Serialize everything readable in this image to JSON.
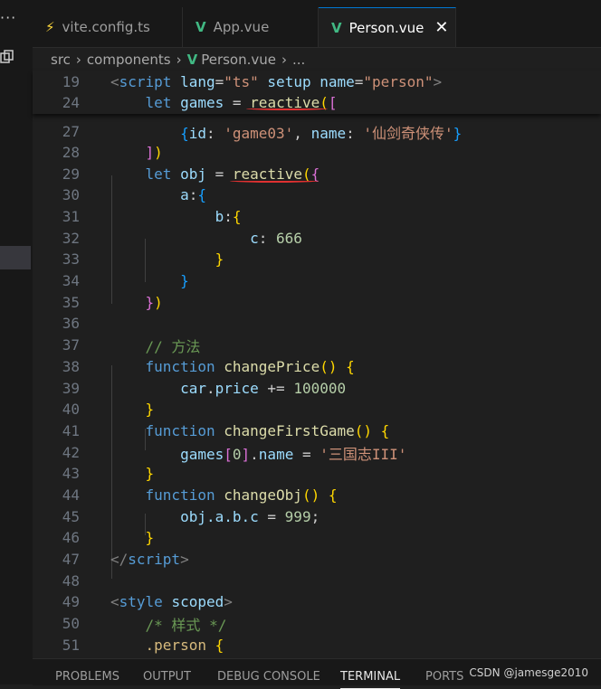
{
  "activity_bar": {
    "more": "···"
  },
  "tabs": [
    {
      "label": "vite.config.ts",
      "icon": "vite-icon"
    },
    {
      "label": "App.vue",
      "icon": "vue-icon"
    },
    {
      "label": "Person.vue",
      "icon": "vue-icon",
      "active": true,
      "close": "✕"
    }
  ],
  "breadcrumb": {
    "part1": "src",
    "part2": "components",
    "part3": "Person.vue",
    "part4": "..."
  },
  "sticky": {
    "l19_num": "19",
    "l19_open": "<",
    "l19_tag": "script",
    "l19_attr1": "lang",
    "l19_eq1": "=",
    "l19_val1": "\"ts\"",
    "l19_attr2": "setup",
    "l19_attr3": "name",
    "l19_eq2": "=",
    "l19_val2": "\"person\"",
    "l19_close": ">",
    "l24_num": "24",
    "l24_let": "let",
    "l24_var": "games",
    "l24_eq": "=",
    "l24_fn": "reactive",
    "l24_p": "(",
    "l24_b": "["
  },
  "lines": {
    "l27": {
      "num": "27",
      "ob": "{",
      "k1": "id",
      "c1": ": ",
      "s1": "'game03'",
      "c2": ", ",
      "k2": "name",
      "c3": ": ",
      "s2": "'仙剑奇侠传'",
      "cb": "}"
    },
    "l28": {
      "num": "28",
      "b": "]",
      "p": ")"
    },
    "l29": {
      "num": "29",
      "let": "let",
      "var": "obj",
      "eq": "=",
      "fn": "reactive",
      "p": "(",
      "b": "{"
    },
    "l30": {
      "num": "30",
      "key": "a",
      "colon": ":",
      "b": "{"
    },
    "l31": {
      "num": "31",
      "key": "b",
      "colon": ":",
      "b": "{"
    },
    "l32": {
      "num": "32",
      "key": "c",
      "colon": ": ",
      "val": "666"
    },
    "l33": {
      "num": "33",
      "b": "}"
    },
    "l34": {
      "num": "34",
      "b": "}"
    },
    "l35": {
      "num": "35",
      "b": "}",
      "p": ")"
    },
    "l36": {
      "num": "36"
    },
    "l37": {
      "num": "37",
      "comment": "// 方法"
    },
    "l38": {
      "num": "38",
      "kw": "function",
      "fn": "changePrice",
      "p": "()",
      "b": "{"
    },
    "l39": {
      "num": "39",
      "obj": "car",
      "dot": ".",
      "prop": "price",
      "op": " += ",
      "val": "100000"
    },
    "l40": {
      "num": "40",
      "b": "}"
    },
    "l41": {
      "num": "41",
      "kw": "function",
      "fn": "changeFirstGame",
      "p": "()",
      "b": "{"
    },
    "l42": {
      "num": "42",
      "obj": "games",
      "bo": "[",
      "idx": "0",
      "bc": "]",
      "dot": ".",
      "prop": "name",
      "op": " = ",
      "val": "'三国志III'"
    },
    "l43": {
      "num": "43",
      "b": "}"
    },
    "l44": {
      "num": "44",
      "kw": "function",
      "fn": "changeObj",
      "p": "()",
      "b": "{"
    },
    "l45": {
      "num": "45",
      "expr": "obj.a.b.c",
      "op": " = ",
      "val": "999",
      "semi": ";"
    },
    "l46": {
      "num": "46",
      "b": "}"
    },
    "l47": {
      "num": "47",
      "open": "</",
      "tag": "script",
      "close": ">"
    },
    "l48": {
      "num": "48"
    },
    "l49": {
      "num": "49",
      "open": "<",
      "tag": "style",
      "attr": "scoped",
      "close": ">"
    },
    "l50": {
      "num": "50",
      "comment": "/* 样式 */"
    },
    "l51": {
      "num": "51",
      "sel": ".person",
      "b": "{"
    }
  },
  "panel": {
    "tabs": [
      "PROBLEMS",
      "OUTPUT",
      "DEBUG CONSOLE",
      "TERMINAL",
      "PORTS"
    ],
    "active": "TERMINAL"
  },
  "watermark": "CSDN @jamesge2010",
  "colors": {
    "accent": "#0078d4",
    "vue": "#41b883",
    "underline": "#e03131"
  }
}
